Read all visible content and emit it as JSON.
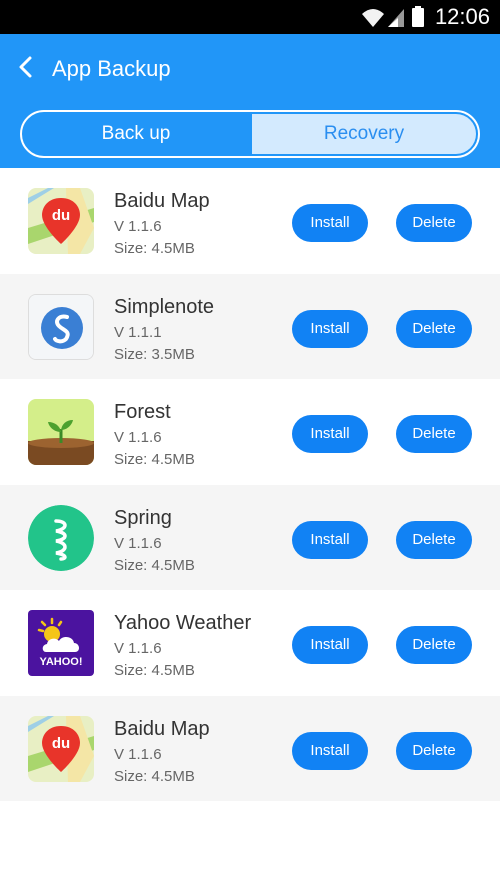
{
  "status_bar": {
    "time": "12:06",
    "icons": [
      "wifi-icon",
      "signal-icon",
      "battery-icon"
    ]
  },
  "header": {
    "title": "App Backup",
    "back_icon": "chevron-left-icon"
  },
  "tabs": [
    {
      "label": "Back up",
      "selected": false
    },
    {
      "label": "Recovery",
      "selected": true
    }
  ],
  "colors": {
    "primary": "#2196f8",
    "button": "#1182f4",
    "tab_selected_bg": "#d3eafe"
  },
  "apps": [
    {
      "name": "Baidu Map",
      "version": "V 1.1.6",
      "size": "Size: 4.5MB",
      "icon": "baidu-map-icon",
      "install_label": "Install",
      "delete_label": "Delete"
    },
    {
      "name": "Simplenote",
      "version": "V 1.1.1",
      "size": "Size: 3.5MB",
      "icon": "simplenote-icon",
      "install_label": "Install",
      "delete_label": "Delete"
    },
    {
      "name": "Forest",
      "version": "V 1.1.6",
      "size": "Size: 4.5MB",
      "icon": "forest-icon",
      "install_label": "Install",
      "delete_label": "Delete"
    },
    {
      "name": "Spring",
      "version": "V 1.1.6",
      "size": "Size: 4.5MB",
      "icon": "spring-icon",
      "install_label": "Install",
      "delete_label": "Delete"
    },
    {
      "name": "Yahoo Weather",
      "version": "V 1.1.6",
      "size": "Size: 4.5MB",
      "icon": "yahoo-weather-icon",
      "icon_text": "YAHOO!",
      "install_label": "Install",
      "delete_label": "Delete"
    },
    {
      "name": "Baidu Map",
      "version": "V 1.1.6",
      "size": "Size: 4.5MB",
      "icon": "baidu-map-icon",
      "install_label": "Install",
      "delete_label": "Delete"
    }
  ]
}
